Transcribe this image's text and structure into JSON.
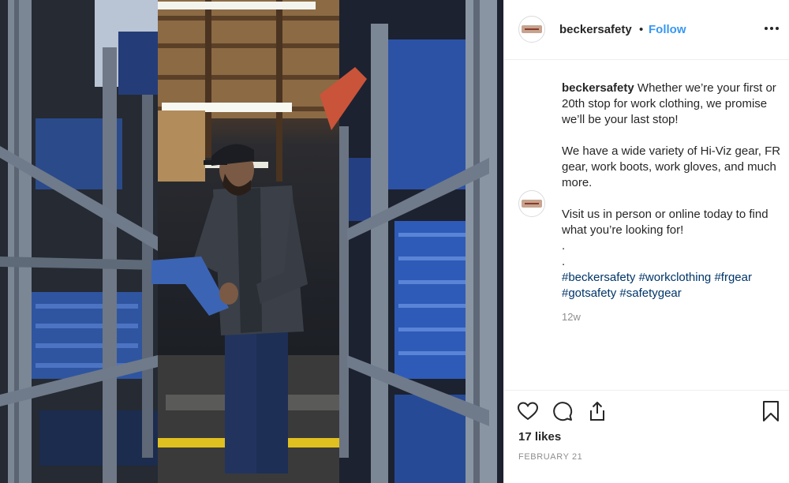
{
  "post": {
    "image_alt": "Man in cap browsing folded jeans between metal warehouse shelves"
  },
  "header": {
    "username": "beckersafety",
    "separator": "•",
    "follow_label": "Follow",
    "more_icon": "more-horizontal-icon"
  },
  "caption": {
    "username": "beckersafety",
    "paragraph_1": "Whether we’re your first or 20th stop for work clothing, we promise we’ll be your last stop!",
    "paragraph_2": "We have a wide variety of Hi-Viz gear, FR gear, work boots, work gloves, and much more.",
    "paragraph_3": "Visit us in person or online today to find what you’re looking for!",
    "dot_1": ".",
    "dot_2": ".",
    "hashtags": [
      "#beckersafety",
      "#workclothing",
      "#frgear",
      "#gotsafety",
      "#safetygear"
    ],
    "time_ago": "12w"
  },
  "actions": {
    "like_icon": "heart-icon",
    "comment_icon": "comment-icon",
    "share_icon": "share-icon",
    "save_icon": "bookmark-icon",
    "likes_text": "17 likes",
    "date_text": "FEBRUARY 21"
  },
  "colors": {
    "follow": "#3897f0",
    "hashtag": "#003569",
    "muted": "#8e8e8e",
    "text": "#262626",
    "border": "#efefef"
  }
}
